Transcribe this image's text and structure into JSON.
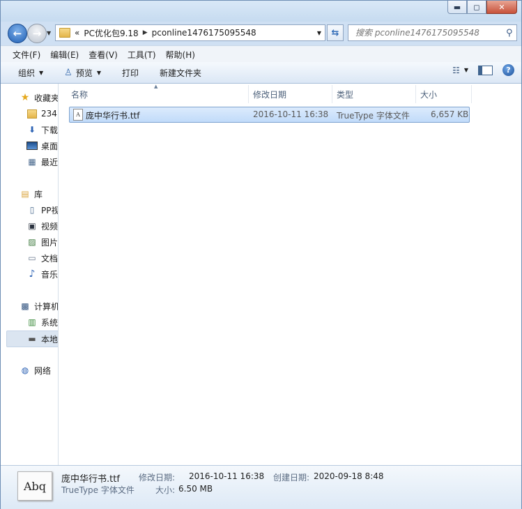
{
  "titlebar": {
    "controls": {
      "min": "▬",
      "max": "◻",
      "close": "✕"
    }
  },
  "address": {
    "overflow": "«",
    "crumbs": [
      "PC优化包9.18",
      "pconline1476175095548"
    ]
  },
  "search": {
    "placeholder": "搜索 pconline1476175095548"
  },
  "menu": {
    "items": [
      "文件(F)",
      "编辑(E)",
      "查看(V)",
      "工具(T)",
      "帮助(H)"
    ]
  },
  "toolbar": {
    "organize": "组织",
    "preview": "预览",
    "print": "打印",
    "new_folder": "新建文件夹",
    "help": "?"
  },
  "navpane": {
    "items": [
      {
        "label": "收藏夹",
        "icon": "star-icon"
      },
      {
        "label": "234",
        "icon": "folder-icon"
      },
      {
        "label": "下载",
        "icon": "downloads-icon"
      },
      {
        "label": "桌面",
        "icon": "desktop-icon"
      },
      {
        "label": "最近",
        "icon": "recent-places-icon"
      },
      {
        "label": "库",
        "icon": "library-icon"
      },
      {
        "label": "PP视",
        "icon": "pptv-icon"
      },
      {
        "label": "视频",
        "icon": "video-icon"
      },
      {
        "label": "图片",
        "icon": "pictures-icon"
      },
      {
        "label": "文档",
        "icon": "documents-icon"
      },
      {
        "label": "音乐",
        "icon": "music-icon"
      },
      {
        "label": "计算机",
        "icon": "computer-icon"
      },
      {
        "label": "系统",
        "icon": "system-drive-icon"
      },
      {
        "label": "本地",
        "icon": "local-disk-icon"
      },
      {
        "label": "网络",
        "icon": "network-icon"
      }
    ]
  },
  "columns": {
    "name": "名称",
    "modified": "修改日期",
    "type": "类型",
    "size": "大小"
  },
  "files": [
    {
      "name": "庞中华行书.ttf",
      "modified": "2016-10-11 16:38",
      "type": "TrueType 字体文件",
      "size": "6,657 KB"
    }
  ],
  "details": {
    "filename": "庞中华行书.ttf",
    "filetype": "TrueType 字体文件",
    "modified_label": "修改日期:",
    "modified_value": "2016-10-11 16:38",
    "created_label": "创建日期:",
    "created_value": "2020-09-18 8:48",
    "size_label": "大小:",
    "size_value": "6.50 MB",
    "icon_text": "Abq"
  }
}
